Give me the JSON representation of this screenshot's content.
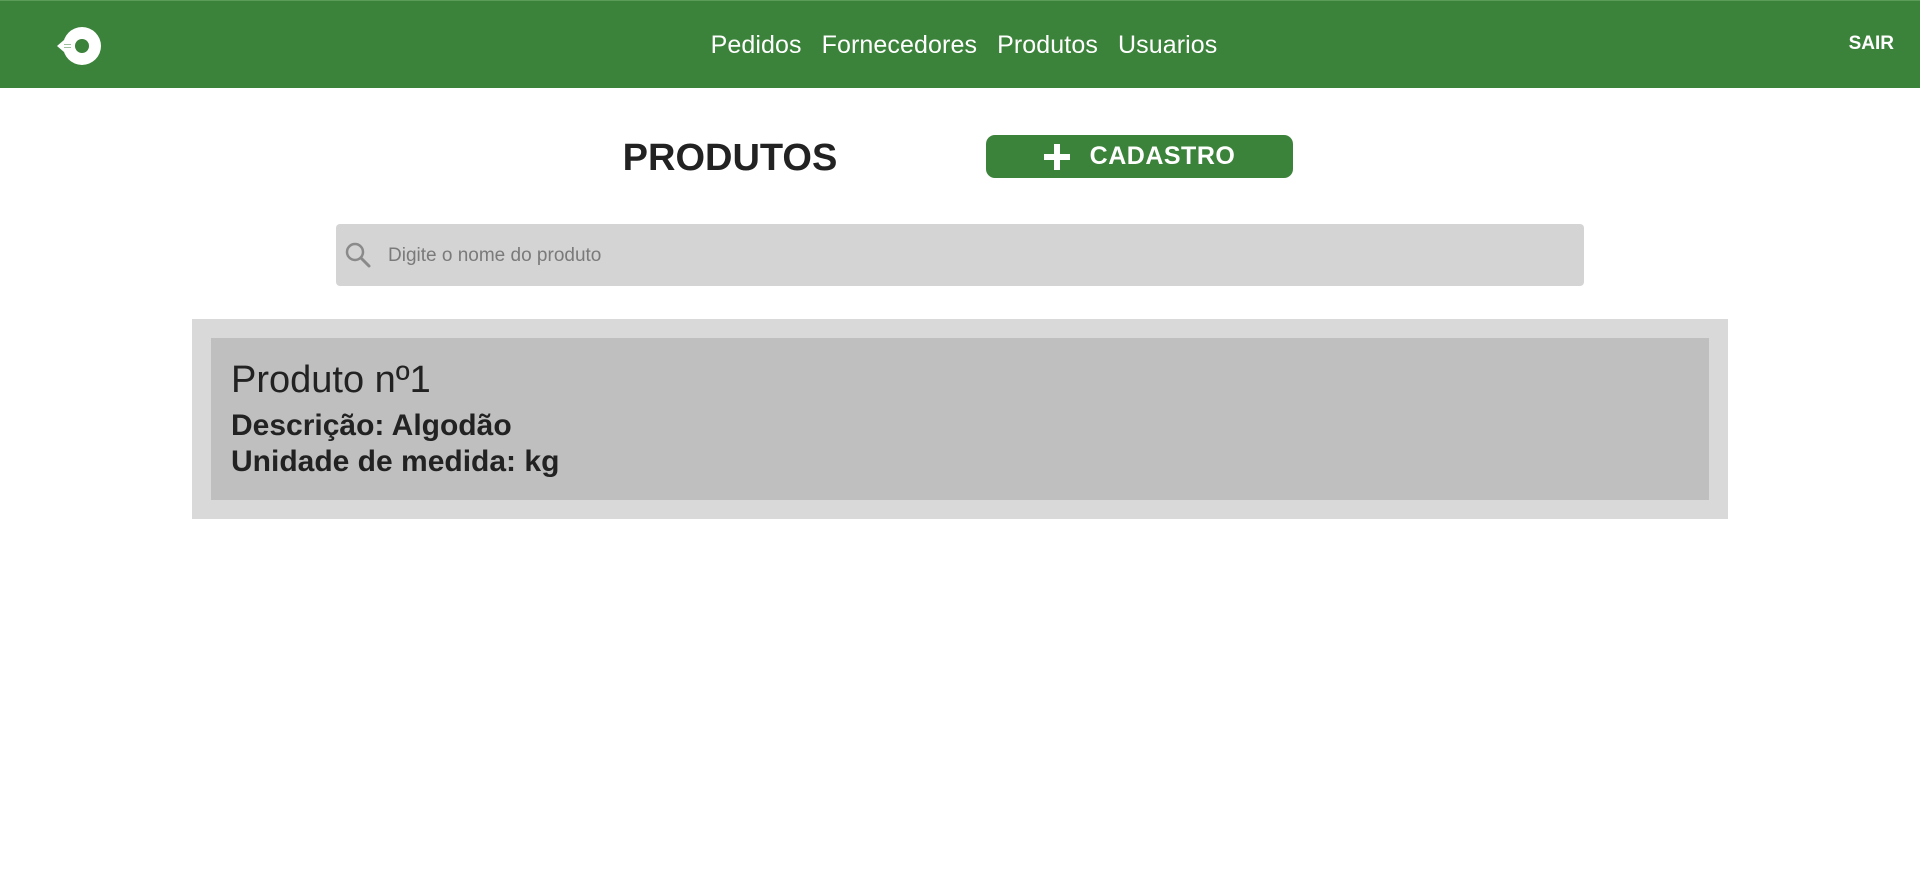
{
  "navbar": {
    "logo_icon": "recycle-arrow-icon",
    "links": [
      "Pedidos",
      "Fornecedores",
      "Produtos",
      "Usuarios"
    ],
    "logout_label": "SAIR",
    "background_color": "#3b823a"
  },
  "main": {
    "title": "PRODUTOS",
    "add_button": {
      "icon": "plus-icon",
      "label": "CADASTRO"
    },
    "search": {
      "icon": "search-icon",
      "placeholder": "Digite o nome do produto",
      "value": ""
    },
    "products": [
      {
        "name": "Produto nº1",
        "description_label": "Descrição:",
        "description_value": "Algodão",
        "unit_label": "Unidade de medida:",
        "unit_value": "kg"
      }
    ]
  }
}
